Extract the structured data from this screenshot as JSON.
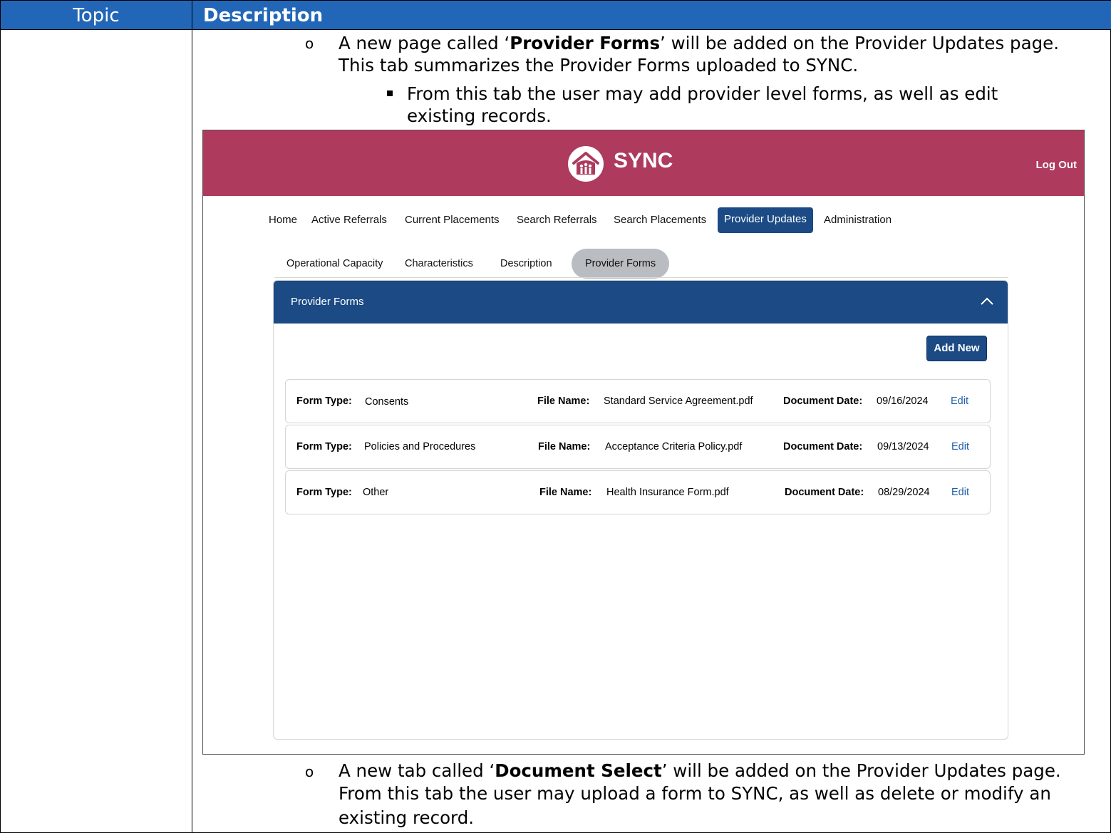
{
  "doc": {
    "header_topic": "Topic",
    "header_description": "Description",
    "para1_prefix": "A new page called ‘",
    "para1_bold": "Provider Forms",
    "para1_suffix": "’ will be added on the Provider Updates page.",
    "para1_line2": "This tab summarizes the Provider Forms uploaded to SYNC.",
    "sub1_line1": "From this tab the user may add provider level forms, as well as edit",
    "sub1_line2": "existing records.",
    "para2_prefix": "A new tab called ‘",
    "para2_bold": "Document Select",
    "para2_suffix": "’ will be added on the Provider Updates page.",
    "para2_line2": "From this tab the user may upload a form to SYNC, as well as delete or modify an",
    "para2_line3": "existing record.",
    "bullet_circle": "o"
  },
  "app": {
    "brand_name": "SYNC",
    "logout_label": "Log Out",
    "brand_color": "#ae3a5e",
    "accent_color": "#1b4a85",
    "nav": [
      "Home",
      "Active Referrals",
      "Current Placements",
      "Search Referrals",
      "Search Placements",
      "Provider Updates",
      "Administration"
    ],
    "nav_active": "Provider Updates",
    "subnav": [
      "Operational Capacity",
      "Characteristics",
      "Description",
      "Provider Forms"
    ],
    "subnav_active": "Provider Forms",
    "panel_title": "Provider Forms",
    "add_button": "Add New",
    "labels": {
      "form_type": "Form Type:",
      "file_name": "File Name:",
      "document_date": "Document Date:",
      "edit": "Edit"
    },
    "rows": [
      {
        "form_type": "Consents",
        "file_name": "Standard Service Agreement.pdf",
        "document_date": "09/16/2024"
      },
      {
        "form_type": "Policies and Procedures",
        "file_name": "Acceptance Criteria Policy.pdf",
        "document_date": "09/13/2024"
      },
      {
        "form_type": "Other",
        "file_name": "Health Insurance Form.pdf",
        "document_date": "08/29/2024"
      }
    ]
  }
}
